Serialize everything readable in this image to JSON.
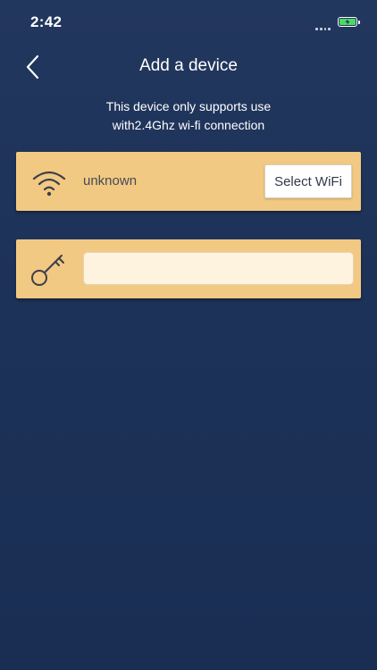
{
  "status_bar": {
    "time": "2:42"
  },
  "nav": {
    "title": "Add a device"
  },
  "notice": {
    "line1": "This device only supports use",
    "line2": "with2.4Ghz wi-fi connection"
  },
  "wifi_card": {
    "network_name": "unknown",
    "select_label": "Select WiFi",
    "icon": "wifi-icon"
  },
  "password_card": {
    "icon": "key-icon",
    "value": "",
    "placeholder": ""
  },
  "colors": {
    "background": "#1d3258",
    "card": "#f2c982",
    "input": "#fdf3df",
    "battery": "#4cd964"
  }
}
